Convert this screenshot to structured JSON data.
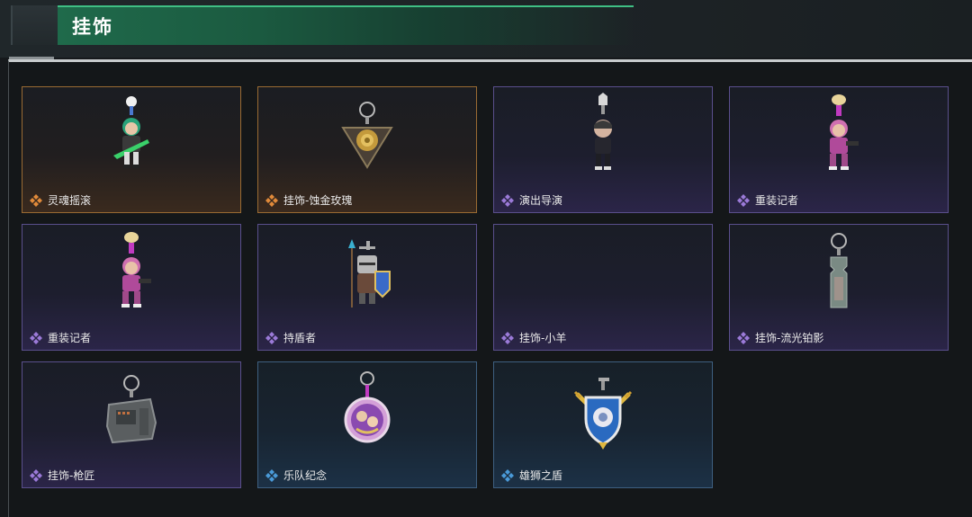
{
  "header": {
    "title": "挂饰"
  },
  "colors": {
    "gold": "#e08a3a",
    "purple": "#9b7ad8",
    "blue": "#4a9ad8",
    "accent_green": "#1f6a4b"
  },
  "items": [
    {
      "label": "灵魂摇滚",
      "rarity": "gold",
      "icon": "rocker-figure-charm"
    },
    {
      "label": "挂饰-蚀金玫瑰",
      "rarity": "gold",
      "icon": "golden-rose-charm"
    },
    {
      "label": "演出导演",
      "rarity": "purple",
      "icon": "director-figure-charm"
    },
    {
      "label": "重装记者",
      "rarity": "purple",
      "icon": "reporter-figure-charm"
    },
    {
      "label": "重装记者",
      "rarity": "purple",
      "icon": "reporter-figure-charm"
    },
    {
      "label": "持盾者",
      "rarity": "purple",
      "icon": "shield-knight-charm"
    },
    {
      "label": "挂饰-小羊",
      "rarity": "purple",
      "icon": "empty"
    },
    {
      "label": "挂饰-流光铂影",
      "rarity": "purple",
      "icon": "silver-tag-charm"
    },
    {
      "label": "挂饰-枪匠",
      "rarity": "purple",
      "icon": "gunsmith-box-charm"
    },
    {
      "label": "乐队纪念",
      "rarity": "blue",
      "icon": "band-badge-charm"
    },
    {
      "label": "雄狮之盾",
      "rarity": "blue",
      "icon": "lion-shield-charm"
    }
  ]
}
